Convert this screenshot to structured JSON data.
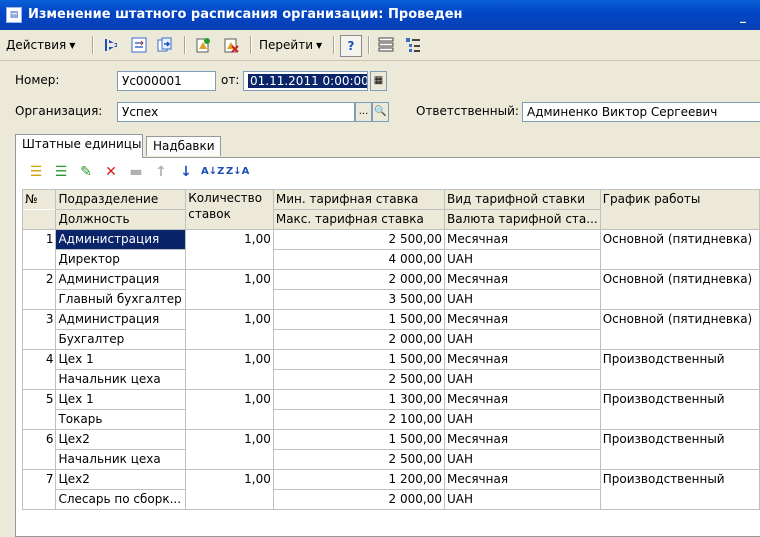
{
  "window": {
    "title": "Изменение штатного расписания организации: Проведен",
    "min_glyph": "_"
  },
  "toolbar": {
    "actions_label": "Действия",
    "goto_label": "Перейти",
    "help_label": "?"
  },
  "form": {
    "number_label": "Номер:",
    "number_value": "Ус000001",
    "date_label": "от:",
    "date_value": "01.11.2011  0:00:00",
    "org_label": "Организация:",
    "org_value": "Успех",
    "resp_label": "Ответственный:",
    "resp_value": "Админенко Виктор Сергеевич"
  },
  "tabs": [
    "Штатные единицы",
    "Надбавки"
  ],
  "grid": {
    "headers": {
      "num": "№",
      "dept": "Подразделение",
      "position": "Должность",
      "count": "Количество ставок",
      "min_rate": "Мин. тарифная ставка",
      "max_rate": "Макс. тарифная ставка",
      "rate_type": "Вид тарифной ставки",
      "currency": "Валюта тарифной ста...",
      "schedule": "График работы"
    },
    "rows": [
      {
        "n": "1",
        "dept": "Администрация",
        "position": "Директор",
        "count": "1,00",
        "min": "2 500,00",
        "max": "4 000,00",
        "type": "Месячная",
        "cur": "UAH",
        "sched": "Основной (пятидневка)"
      },
      {
        "n": "2",
        "dept": "Администрация",
        "position": "Главный бухгалтер",
        "count": "1,00",
        "min": "2 000,00",
        "max": "3 500,00",
        "type": "Месячная",
        "cur": "UAH",
        "sched": "Основной (пятидневка)"
      },
      {
        "n": "3",
        "dept": "Администрация",
        "position": "Бухгалтер",
        "count": "1,00",
        "min": "1 500,00",
        "max": "2 000,00",
        "type": "Месячная",
        "cur": "UAH",
        "sched": "Основной (пятидневка)"
      },
      {
        "n": "4",
        "dept": "Цех 1",
        "position": "Начальник цеха",
        "count": "1,00",
        "min": "1 500,00",
        "max": "2 500,00",
        "type": "Месячная",
        "cur": "UAH",
        "sched": "Производственный"
      },
      {
        "n": "5",
        "dept": "Цех 1",
        "position": "Токарь",
        "count": "1,00",
        "min": "1 300,00",
        "max": "2 100,00",
        "type": "Месячная",
        "cur": "UAH",
        "sched": "Производственный"
      },
      {
        "n": "6",
        "dept": "Цех2",
        "position": "Начальник цеха",
        "count": "1,00",
        "min": "1 500,00",
        "max": "2 500,00",
        "type": "Месячная",
        "cur": "UAH",
        "sched": "Производственный"
      },
      {
        "n": "7",
        "dept": "Цех2",
        "position": "Слесарь по сборк...",
        "count": "1,00",
        "min": "1 200,00",
        "max": "2 000,00",
        "type": "Месячная",
        "cur": "UAH",
        "sched": "Производственный"
      }
    ]
  }
}
